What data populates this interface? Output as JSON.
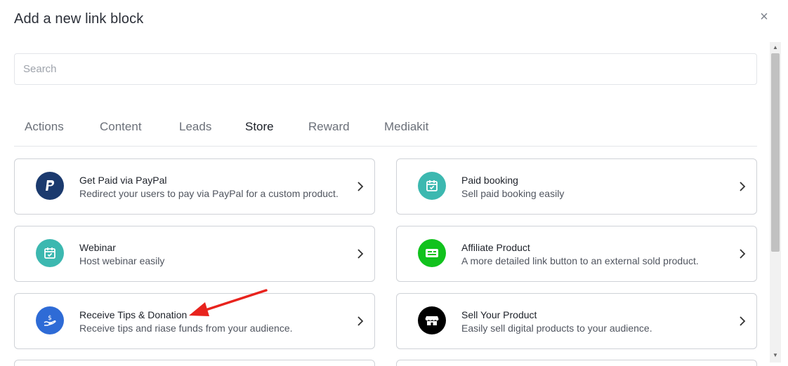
{
  "modal": {
    "title": "Add a new link block",
    "close_label": "×"
  },
  "search": {
    "placeholder": "Search",
    "value": ""
  },
  "tabs": [
    {
      "label": "Actions",
      "active": false
    },
    {
      "label": "Content",
      "active": false
    },
    {
      "label": "Leads",
      "active": false
    },
    {
      "label": "Store",
      "active": true
    },
    {
      "label": "Reward",
      "active": false
    },
    {
      "label": "Mediakit",
      "active": false
    }
  ],
  "cards": [
    {
      "title": "Get Paid via PayPal",
      "description": "Redirect your users to pay via PayPal for a custom product.",
      "icon": "paypal-icon",
      "icon_color": "#1b3a6e"
    },
    {
      "title": "Paid booking",
      "description": "Sell paid booking easily",
      "icon": "calendar-check-icon",
      "icon_color": "#3cb8b0"
    },
    {
      "title": "Webinar",
      "description": "Host webinar easily",
      "icon": "calendar-check-icon",
      "icon_color": "#3cb8b0"
    },
    {
      "title": "Affiliate Product",
      "description": "A more detailed link button to an external sold product.",
      "icon": "id-card-icon",
      "icon_color": "#11c21d"
    },
    {
      "title": "Receive Tips & Donation",
      "description": "Receive tips and riase funds from your audience.",
      "icon": "hand-dollar-icon",
      "icon_color": "#2e6bd6"
    },
    {
      "title": "Sell Your Product",
      "description": "Easily sell digital products to your audience.",
      "icon": "storefront-icon",
      "icon_color": "#000000"
    }
  ],
  "annotation": {
    "icon": "red-arrow-icon",
    "color": "#e8231d"
  }
}
